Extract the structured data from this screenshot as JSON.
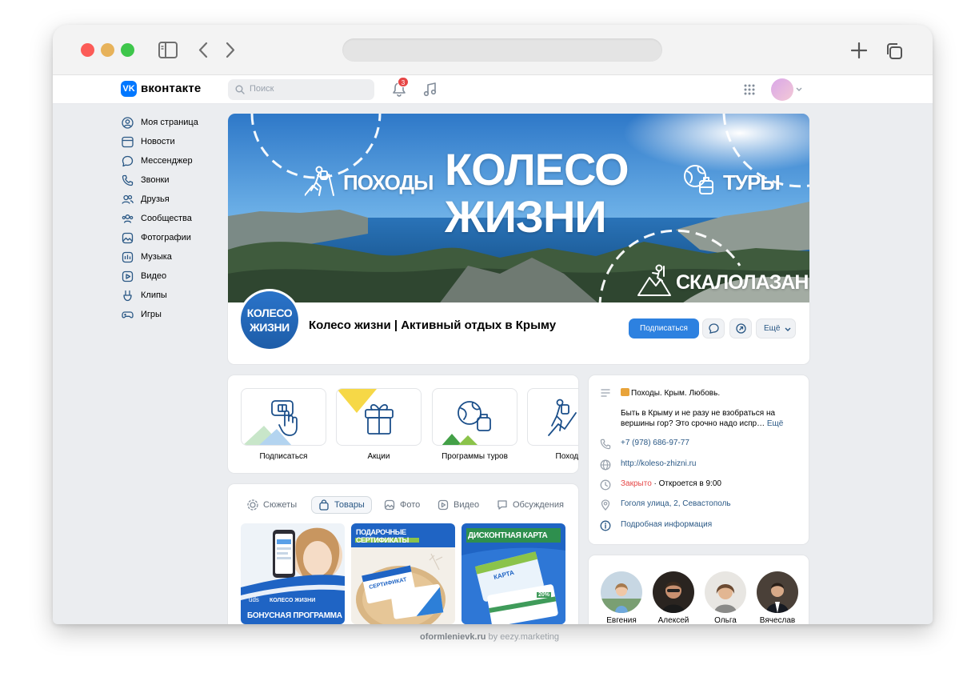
{
  "header": {
    "logo_text": "вконтакте",
    "logo_mark": "VK",
    "search_placeholder": "Поиск",
    "notifications_count": "3"
  },
  "sidebar": {
    "items": [
      {
        "label": "Моя страница",
        "icon": "user-circle-icon"
      },
      {
        "label": "Новости",
        "icon": "newspaper-icon"
      },
      {
        "label": "Мессенджер",
        "icon": "message-icon"
      },
      {
        "label": "Звонки",
        "icon": "phone-icon"
      },
      {
        "label": "Друзья",
        "icon": "friends-icon"
      },
      {
        "label": "Сообщества",
        "icon": "communities-icon"
      },
      {
        "label": "Фотографии",
        "icon": "photo-icon"
      },
      {
        "label": "Музыка",
        "icon": "music-icon"
      },
      {
        "label": "Видео",
        "icon": "video-icon"
      },
      {
        "label": "Клипы",
        "icon": "clips-icon"
      },
      {
        "label": "Игры",
        "icon": "gamepad-icon"
      }
    ]
  },
  "cover": {
    "title_line1": "КОЛЕСО",
    "title_line2": "ЖИЗНИ",
    "label_left": "ПОХОДЫ",
    "label_right": "ТУРЫ",
    "label_bottom": "СКАЛОЛАЗАНИЕ"
  },
  "group": {
    "avatar_line1": "КОЛЕСО",
    "avatar_line2": "ЖИЗНИ",
    "name": "Колесо жизни | Активный отдых в Крыму",
    "subscribe_label": "Подписаться",
    "more_label": "Ещё"
  },
  "tiles": [
    {
      "label": "Подписаться"
    },
    {
      "label": "Акции"
    },
    {
      "label": "Программы туров"
    },
    {
      "label": "Походы"
    }
  ],
  "tabs": [
    {
      "label": "Сюжеты",
      "active": false
    },
    {
      "label": "Товары",
      "active": true
    },
    {
      "label": "Фото",
      "active": false
    },
    {
      "label": "Видео",
      "active": false
    },
    {
      "label": "Обсуждения",
      "active": false
    }
  ],
  "products": [
    {
      "caption": "БОНУСНАЯ ПРОГРАММА",
      "brand": "КОЛЕСО ЖИЗНИ",
      "sub": "uds"
    },
    {
      "caption": "ПОДАРОЧНЫЕ СЕРТИФИКАТЫ",
      "card_text": "СЕРТИФИКАТ"
    },
    {
      "caption": "ДИСКОНТНАЯ КАРТА",
      "card_text": "КАРТА",
      "percent": "20%"
    }
  ],
  "info": {
    "status": "Походы. Крым. Любовь.",
    "description": "Быть в Крыму и не разу не взобраться на вершины гор? Это срочно надо испр…",
    "description_more": "Ещё",
    "phone": "+7 (978) 686-97-77",
    "website": "http://koleso-zhizni.ru",
    "closed": "Закрыто",
    "opens": " · Откроется в 9:00",
    "address": "Гоголя улица, 2, Севастополь",
    "details": "Подробная информация"
  },
  "friends": [
    {
      "name": "Евгения"
    },
    {
      "name": "Алексей"
    },
    {
      "name": "Ольга"
    },
    {
      "name": "Вячеслав"
    }
  ],
  "footer": {
    "site": "oformlenievk.ru",
    "by": " by eezy.marketing"
  },
  "colors": {
    "vk_blue": "#0077ff",
    "button_blue": "#2d81e0",
    "link": "#2a5885",
    "closed_red": "#e64646",
    "badge_red": "#e64646"
  }
}
